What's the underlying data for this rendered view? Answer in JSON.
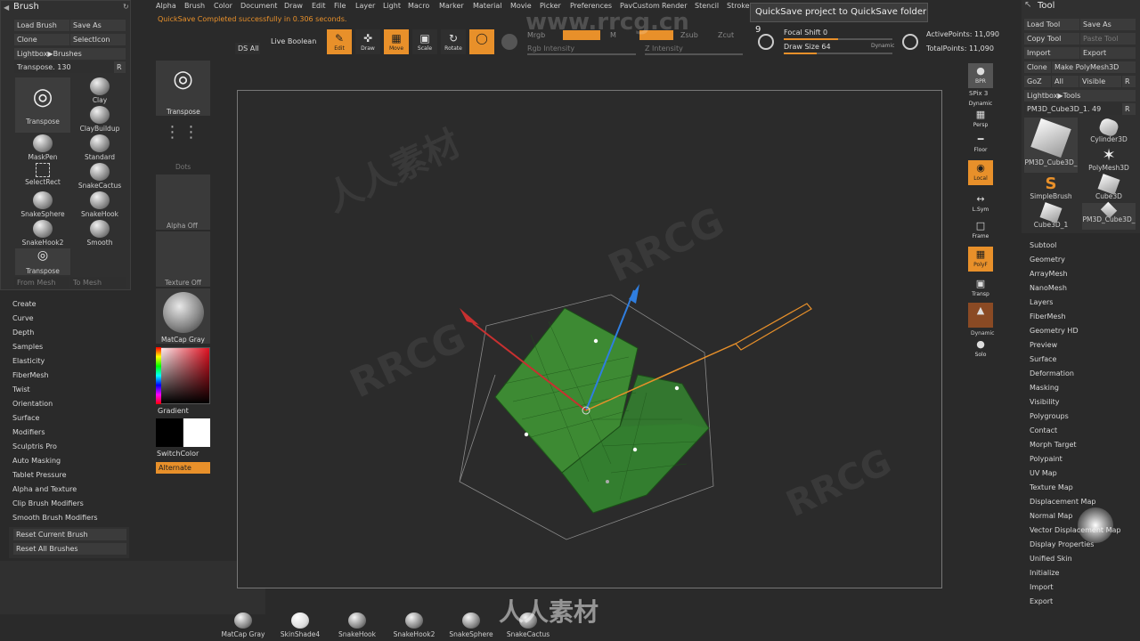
{
  "menubar": [
    "Alpha",
    "Brush",
    "Color",
    "Document",
    "Draw",
    "Edit",
    "File",
    "Layer",
    "Light",
    "Macro",
    "Marker",
    "Material",
    "Movie",
    "Picker",
    "Preferences",
    "PavCustom",
    "Render",
    "Stencil",
    "Stroke"
  ],
  "notice": "QuickSave Completed successfully in 0.306 seconds.",
  "tooltip": "QuickSave project to QuickSave folder  9",
  "stats": {
    "active": "ActivePoints: 11,090",
    "total": "TotalPoints: 11,090"
  },
  "focal": {
    "shift": "Focal Shift 0",
    "draw_size": "Draw Size 64",
    "dynamic": "Dynamic"
  },
  "toolbar": {
    "ds_all": "DS All",
    "live_boolean": "Live Boolean",
    "edit": "Edit",
    "draw": "Draw",
    "move": "Move",
    "scale": "Scale",
    "rotate": "Rotate",
    "mrgb": "Mrgb",
    "rgb": "Rgb",
    "m": "M",
    "zadd": "Zadd",
    "zsub": "Zsub",
    "zcut": "Zcut",
    "rgb_intensity": "Rgb Intensity",
    "z_intensity": "Z Intensity"
  },
  "brush": {
    "title": "Brush",
    "load": "Load Brush",
    "save_as": "Save As",
    "clone": "Clone",
    "select_icon": "SelectIcon",
    "lightbox": "Lightbox▶Brushes",
    "transpose": "Transpose. 130",
    "r": "R",
    "items": [
      "Transpose",
      "Clay",
      "ClayBuildup",
      "MaskPen",
      "Standard",
      "SelectRect",
      "SnakeCactus",
      "SnakeSphere",
      "SnakeHook",
      "SnakeHook2",
      "Smooth",
      "Transpose"
    ],
    "from_mesh": "From Mesh",
    "to_mesh": "To Mesh",
    "menu": [
      "Create",
      "Curve",
      "Depth",
      "Samples",
      "Elasticity",
      "FiberMesh",
      "Twist",
      "Orientation",
      "Surface",
      "Modifiers",
      "Sculptris Pro",
      "Auto Masking",
      "Tablet Pressure",
      "Alpha and Texture",
      "Clip Brush Modifiers",
      "Smooth Brush Modifiers"
    ],
    "reset_current": "Reset Current Brush",
    "reset_all": "Reset All Brushes"
  },
  "column2": {
    "transpose": "Transpose",
    "dots": "Dots",
    "alpha_off": "Alpha Off",
    "texture_off": "Texture Off",
    "matcap": "MatCap Gray",
    "gradient": "Gradient",
    "switch_color": "SwitchColor",
    "alternate": "Alternate"
  },
  "shelf_right": {
    "bpr": "BPR",
    "spix": "SPix 3",
    "dynamic": "Dynamic",
    "persp": "Persp",
    "floor": "Floor",
    "local": "Local",
    "lsym": "L.Sym",
    "frame": "Frame",
    "polyf": "PolyF",
    "transp": "Transp",
    "dynamic2": "Dynamic",
    "solo": "Solo"
  },
  "tool": {
    "title": "Tool",
    "load": "Load Tool",
    "save_as": "Save As",
    "copy": "Copy Tool",
    "paste": "Paste Tool",
    "import": "Import",
    "export": "Export",
    "clone": "Clone",
    "make_poly": "Make PolyMesh3D",
    "goz": "GoZ",
    "all": "All",
    "visible": "Visible",
    "r": "R",
    "lightbox": "Lightbox▶Tools",
    "current": "PM3D_Cube3D_1. 49",
    "meshes": [
      "PM3D_Cube3D_",
      "Cylinder3D",
      "PolyMesh3D",
      "SimpleBrush",
      "Cube3D",
      "Cube3D_1",
      "PM3D_Cube3D_"
    ],
    "menu": [
      "Subtool",
      "Geometry",
      "ArrayMesh",
      "NanoMesh",
      "Layers",
      "FiberMesh",
      "Geometry HD",
      "Preview",
      "Surface",
      "Deformation",
      "Masking",
      "Visibility",
      "Polygroups",
      "Contact",
      "Morph Target",
      "Polypaint",
      "UV Map",
      "Texture Map",
      "Displacement Map",
      "Normal Map",
      "Vector Displacement Map",
      "Display Properties",
      "Unified Skin",
      "Initialize",
      "Import",
      "Export"
    ]
  },
  "bottom_shelf": [
    "MatCap Gray",
    "SkinShade4",
    "SnakeHook",
    "SnakeHook2",
    "SnakeSphere",
    "SnakeCactus"
  ],
  "watermark": {
    "site": "www.rrcg.cn",
    "brand": "RRCG",
    "cn": "人人素材"
  },
  "colors": {
    "accent": "#e8902a",
    "mesh": "#3e8a34",
    "panel": "#303030"
  }
}
